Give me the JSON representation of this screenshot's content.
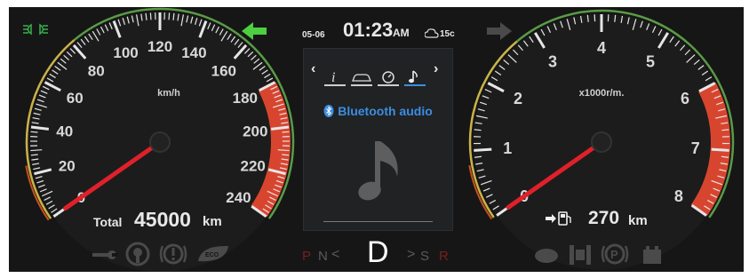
{
  "header": {
    "date": "05-06",
    "time": "01:23",
    "ampm": "AM",
    "temperature": "15c"
  },
  "speedometer": {
    "unit": "km/h",
    "ticks": [
      "0",
      "20",
      "40",
      "60",
      "80",
      "100",
      "120",
      "140",
      "160",
      "180",
      "200",
      "220",
      "240"
    ],
    "value": 0,
    "max": 240,
    "redline_start": 180
  },
  "tachometer": {
    "unit": "x1000r/m.",
    "ticks": [
      "0",
      "1",
      "2",
      "3",
      "4",
      "5",
      "6",
      "7",
      "8"
    ],
    "value": 0,
    "max": 8,
    "redline_start": 6
  },
  "odometer": {
    "label": "Total",
    "value": "45000",
    "unit": "km"
  },
  "fuel_range": {
    "value": "270",
    "unit": "km"
  },
  "media": {
    "title": "Bluetooth audio",
    "tabs": [
      "info-icon",
      "car-icon",
      "gauge-icon",
      "music-note-icon"
    ],
    "active_tab": 3
  },
  "gears": {
    "p": "P",
    "n": "N",
    "d": "D",
    "s": "S",
    "r": "R",
    "left_arrow": "<",
    "right_arrow": ">"
  },
  "colors": {
    "accent": "#3b8ee0",
    "needle": "#e0202a",
    "redzone": "#d8452f",
    "indicator_green": "#37b24d"
  }
}
